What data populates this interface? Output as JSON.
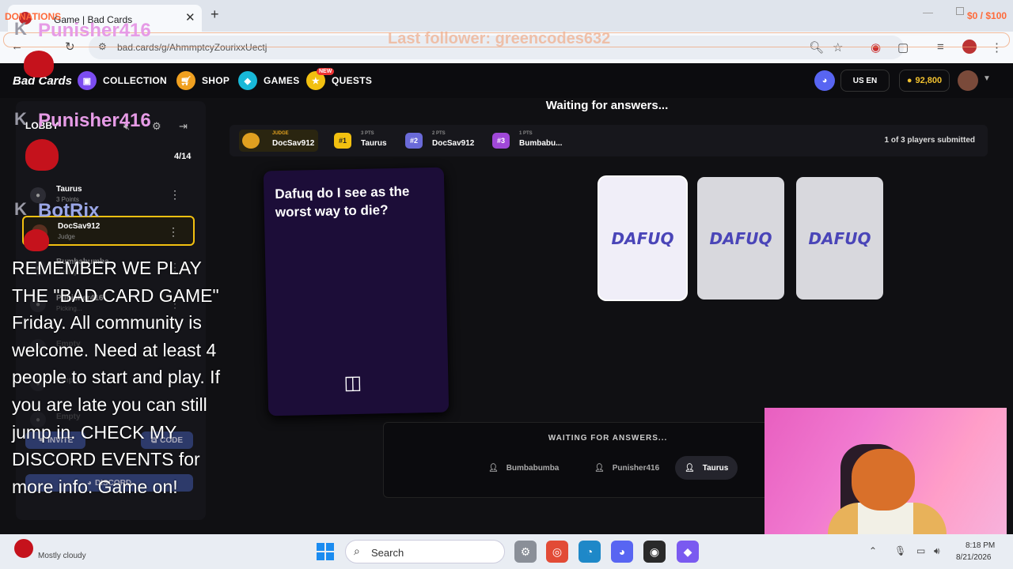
{
  "browser": {
    "tab_title": "Game | Bad Cards",
    "tab_close": "✕",
    "new_tab": "+",
    "url": "bad.cards/g/AhmmptcyZourixxUectj",
    "minimize": "—",
    "icons": [
      "back-icon",
      "reload-icon",
      "tune-icon",
      "zoom-icon",
      "star-icon",
      "extension-icon",
      "puzzle-icon",
      "menu-icon",
      "profile-icon",
      "more-icon"
    ]
  },
  "stream_overlay": {
    "donations_label": "DONATIONS",
    "donation_goal": "$0 / $100",
    "last_follower": "Last follower: greencodes632",
    "streamer_name": "Punisher416",
    "bot_name": "BotRix",
    "message": "REMEMBER WE PLAY THE \"BAD CARD GAME\" Friday. All community is welcome. Need at least 4 people to start and play. If you are late you can still jump in. CHECK MY DISCORD EVENTS for more info. Game on!"
  },
  "site_header": {
    "logo": "Bad Cards",
    "nav": [
      {
        "label": "COLLECTION",
        "icon": "collection-icon",
        "color": "#7b4cf0"
      },
      {
        "label": "SHOP",
        "icon": "cart-icon",
        "color": "#f0a020"
      },
      {
        "label": "GAMES",
        "icon": "games-icon",
        "color": "#18b8d8"
      },
      {
        "label": "QUESTS",
        "icon": "quest-icon",
        "color": "#f2c010"
      }
    ],
    "new_badge": "NEW",
    "language": "US EN",
    "coins": "92,800"
  },
  "lobby": {
    "title": "LOBBY",
    "count": "4/14",
    "players": [
      {
        "name": "Taurus",
        "sub": "3 Points"
      },
      {
        "name": "DocSav912",
        "sub": "Judge"
      },
      {
        "name": "Bumbabumba",
        "sub": "Picking..."
      },
      {
        "name": "Punisher416",
        "sub": "Picking..."
      },
      {
        "name": "Empty",
        "sub": ""
      },
      {
        "name": "Empty",
        "sub": ""
      },
      {
        "name": "Empty",
        "sub": ""
      }
    ],
    "invite": "INVITE",
    "code": "CODE",
    "discord": "DISCORD"
  },
  "game": {
    "status": "Waiting for answers...",
    "scoreboard": [
      {
        "rank": "",
        "sub": "JUDGE",
        "name": "DocSav912",
        "color": "#e0a020"
      },
      {
        "rank": "#1",
        "sub": "3 PTS",
        "name": "Taurus",
        "color": "#f2c010"
      },
      {
        "rank": "#2",
        "sub": "2 PTS",
        "name": "DocSav912",
        "color": "#6a6ad8"
      },
      {
        "rank": "#3",
        "sub": "1 PTS",
        "name": "Bumbabu...",
        "color": "#a048d8"
      }
    ],
    "submitted": "1 of 3 players submitted",
    "question": "Dafuq do I see as the worst way to die?",
    "answer_card_logo": "DAFUQ",
    "waiting_label": "WAITING FOR ANSWERS...",
    "waiting_players": [
      "Bumbabumba",
      "Punisher416",
      "Taurus"
    ]
  },
  "taskbar": {
    "weather": "Mostly cloudy",
    "search": "Search",
    "time": "8:18 PM",
    "date": "8/21/2026"
  }
}
